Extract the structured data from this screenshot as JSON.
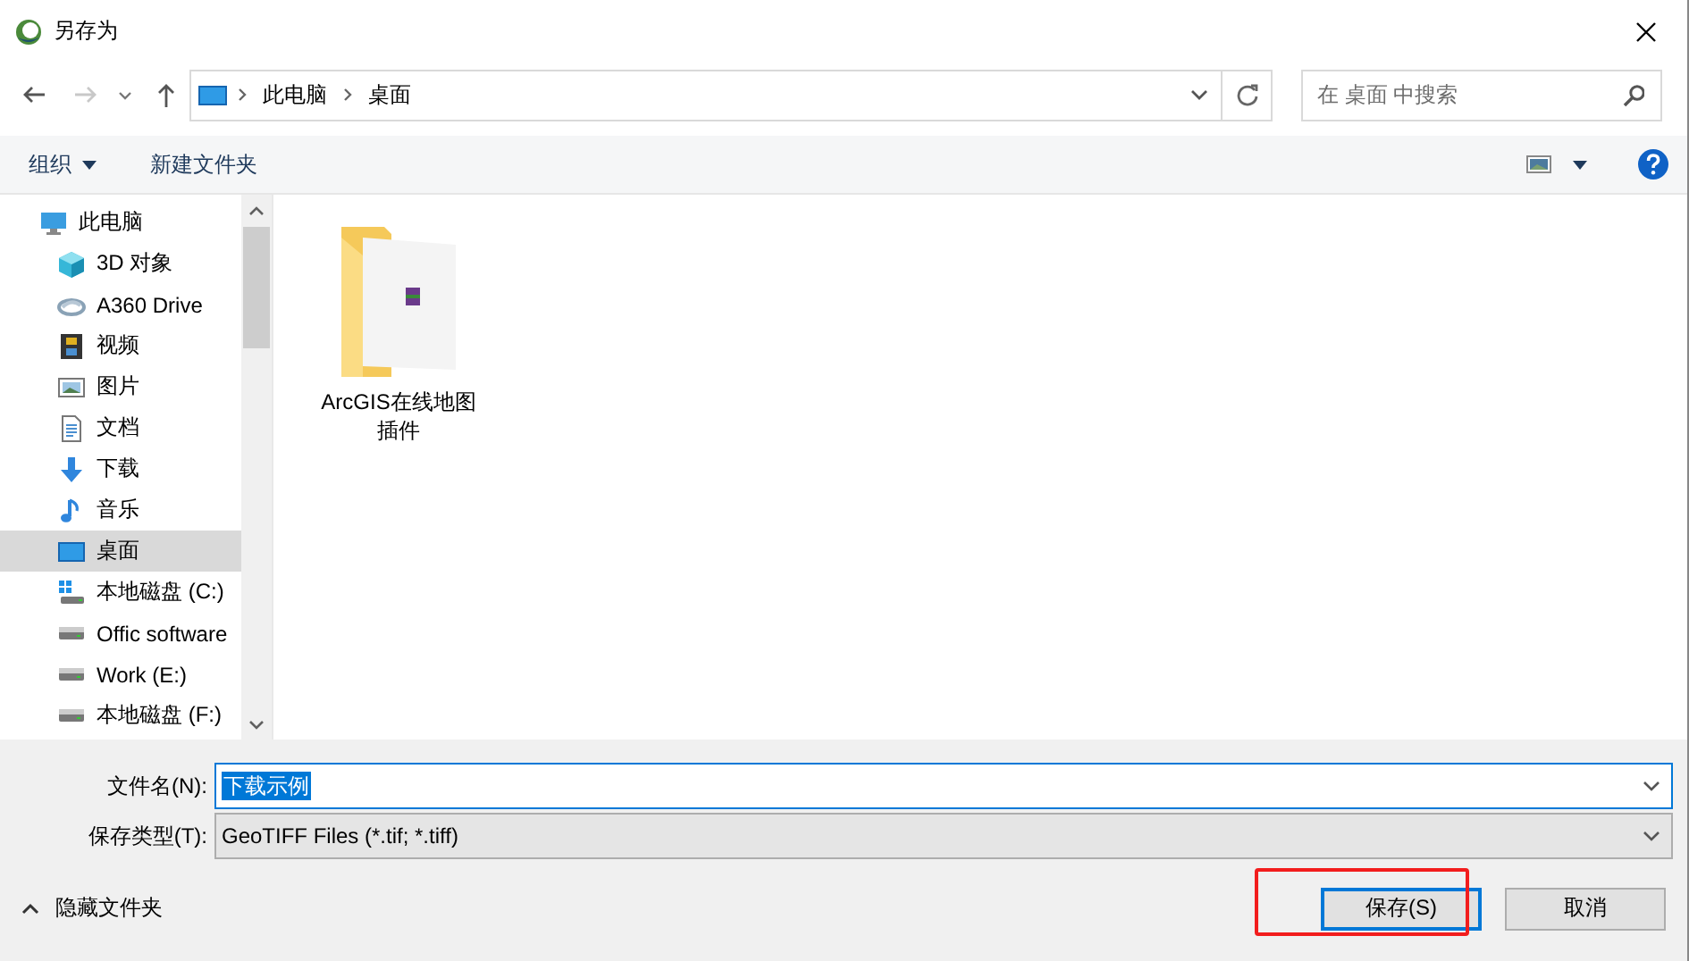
{
  "window": {
    "title": "另存为"
  },
  "address_bar": {
    "path": [
      "此电脑",
      "桌面"
    ]
  },
  "search": {
    "placeholder": "在 桌面 中搜索"
  },
  "toolbar": {
    "organize": "组织",
    "new_folder": "新建文件夹"
  },
  "sidebar": {
    "items": [
      {
        "label": "此电脑",
        "kind": "pc",
        "selected": false,
        "children": [
          {
            "label": "3D 对象",
            "kind": "cube",
            "selected": false
          },
          {
            "label": "A360 Drive",
            "kind": "cloud",
            "selected": false
          },
          {
            "label": "视频",
            "kind": "video",
            "selected": false
          },
          {
            "label": "图片",
            "kind": "pictures",
            "selected": false
          },
          {
            "label": "文档",
            "kind": "documents",
            "selected": false
          },
          {
            "label": "下载",
            "kind": "downloads",
            "selected": false
          },
          {
            "label": "音乐",
            "kind": "music",
            "selected": false
          },
          {
            "label": "桌面",
            "kind": "desktop",
            "selected": true
          },
          {
            "label": "本地磁盘 (C:)",
            "kind": "system-drive",
            "selected": false
          },
          {
            "label": "Offic software",
            "kind": "drive",
            "selected": false
          },
          {
            "label": "Work (E:)",
            "kind": "drive",
            "selected": false
          },
          {
            "label": "本地磁盘 (F:)",
            "kind": "drive",
            "selected": false
          }
        ]
      }
    ]
  },
  "files": [
    {
      "name": "ArcGIS在线地图插件",
      "kind": "folder"
    }
  ],
  "form": {
    "filename_label": "文件名(N):",
    "filename": "下载示例",
    "filename_selected": true,
    "type_label": "保存类型(T):",
    "type": "GeoTIFF Files (*.tif; *.tiff)"
  },
  "hide_folders": "隐藏文件夹",
  "buttons": [
    {
      "label": "保存(S)",
      "kind": "primary",
      "highlighted": true
    },
    {
      "label": "取消",
      "kind": "secondary",
      "highlighted": false
    }
  ]
}
